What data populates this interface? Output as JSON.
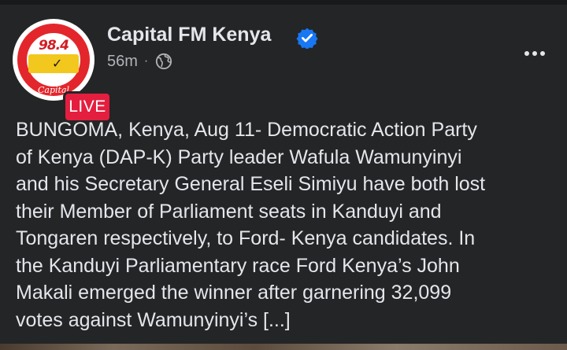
{
  "post": {
    "page_name": "Capital FM Kenya",
    "verified": true,
    "time_ago": "56m",
    "separator": "·",
    "audience_icon": "globe-icon",
    "live_label": "LIVE",
    "avatar": {
      "frequency": "98.4",
      "brand": "Capital"
    },
    "more_icon": "more-horizontal-icon",
    "text_lines": [
      "BUNGOMA, Kenya, Aug 11- Democratic Action Party",
      "of Kenya (DAP-K) Party leader Wafula Wamunyinyi",
      "and his Secretary General Eseli Simiyu have both lost",
      "their Member of Parliament seats in Kanduyi and",
      "Tongaren respectively, to Ford- Kenya candidates. In",
      "the Kanduyi Parliamentary race Ford Kenya’s John",
      "Makali emerged the winner after garnering 32,099",
      "votes against Wamunyinyi’s [...]"
    ]
  },
  "colors": {
    "card_background": "#242526",
    "primary_text": "#e4e6eb",
    "secondary_text": "#b0b3b8",
    "verified_blue": "#1877f2",
    "live_red": "#e41e3f"
  }
}
